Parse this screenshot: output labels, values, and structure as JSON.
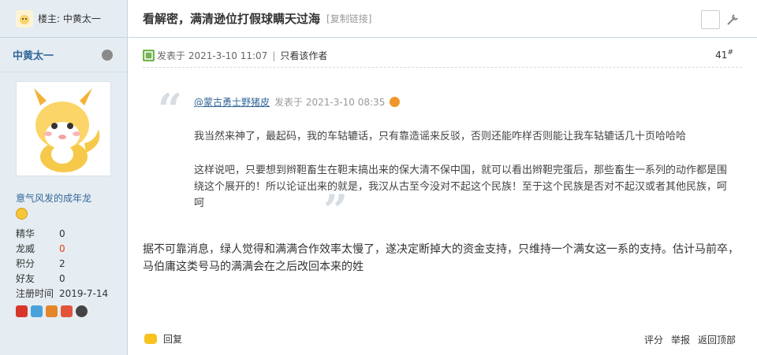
{
  "sidebar": {
    "op_label": "楼主: 中黄太一",
    "author_name": "中黄太一",
    "group": "意气风发的成年龙",
    "stats": [
      {
        "label": "精华",
        "value": "0"
      },
      {
        "label": "龙威",
        "value": "0"
      },
      {
        "label": "积分",
        "value": "2"
      },
      {
        "label": "好友",
        "value": "0"
      },
      {
        "label": "注册时间",
        "value": "2019-7-14"
      }
    ]
  },
  "thread": {
    "title": "看解密，满清逊位打假球瞒天过海",
    "copy_link": "[复制链接]"
  },
  "post": {
    "posted_at": "发表于 2021-3-10 11:07",
    "only_author": "只看该作者",
    "floor": "41",
    "floor_mark": "#",
    "quote": {
      "user": "@蒙古勇士野猪皮",
      "posted_at": "发表于 2021-3-10 08:35",
      "p1": "我当然来神了，最起码，我的车轱辘话，只有靠造谣来反驳，否则还能咋样否则能让我车轱辘话几十页哈哈哈",
      "p2": "这样说吧，只要想到辫靼畜生在靼末搞出来的保大清不保中国，就可以看出辫靼完蛋后，那些畜生一系列的动作都是围绕这个展开的！所以论证出来的就是，我汉从古至今没对不起这个民族！至于这个民族是否对不起汉或者其他民族，呵呵"
    },
    "body": "据不可靠消息，绿人觉得和满满合作效率太慢了，遂决定断掉大的资金支持，只维持一个满女这一系的支持。估计马前卒，马伯庸这类号马的满满会在之后改回本来的姓"
  },
  "footer": {
    "reply": "回复",
    "rate": "评分",
    "report": "举报",
    "back_top": "返回顶部"
  }
}
